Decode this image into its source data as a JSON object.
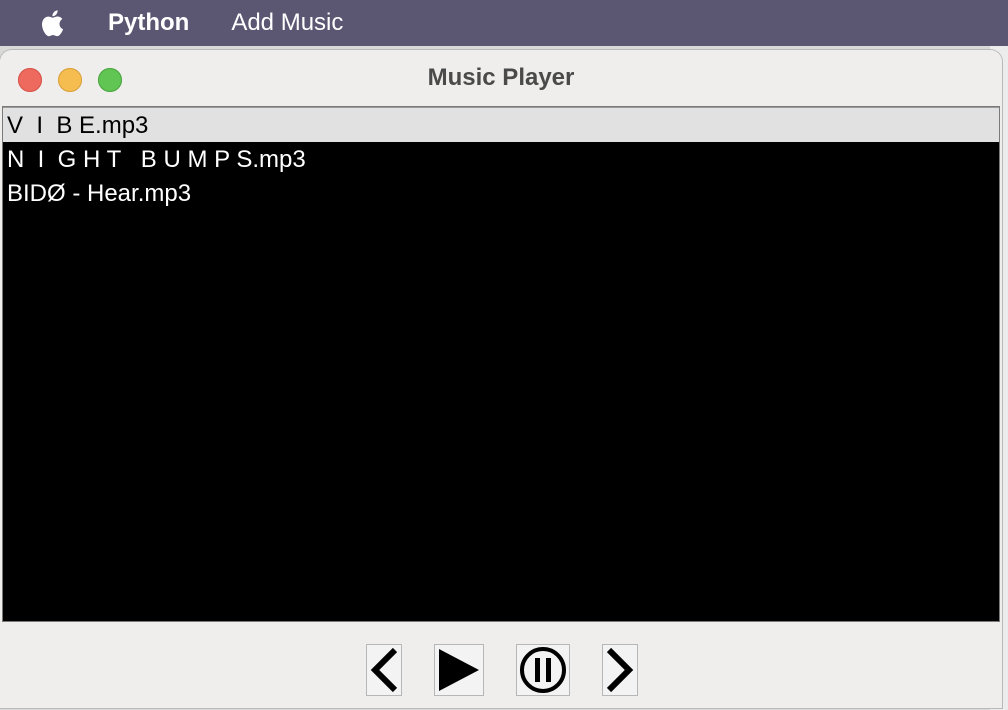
{
  "menubar": {
    "app_name": "Python",
    "items": [
      "Add Music"
    ]
  },
  "window": {
    "title": "Music Player"
  },
  "playlist": {
    "tracks": [
      "V  I  B E.mp3",
      "N  I  G H T   B U M P S.mp3",
      "BIDØ - Hear.mp3"
    ],
    "selected_index": 0
  },
  "controls": {
    "icons": [
      "chevron-left-icon",
      "play-icon",
      "pause-icon",
      "chevron-right-icon"
    ]
  },
  "colors": {
    "menubar_bg": "#5b5672",
    "window_bg": "#efeeed",
    "playlist_bg": "#000000",
    "selected_row_bg": "#e1e1e1",
    "close": "#ee6a5f",
    "minimize": "#f5bd4f",
    "maximize": "#61c554"
  }
}
